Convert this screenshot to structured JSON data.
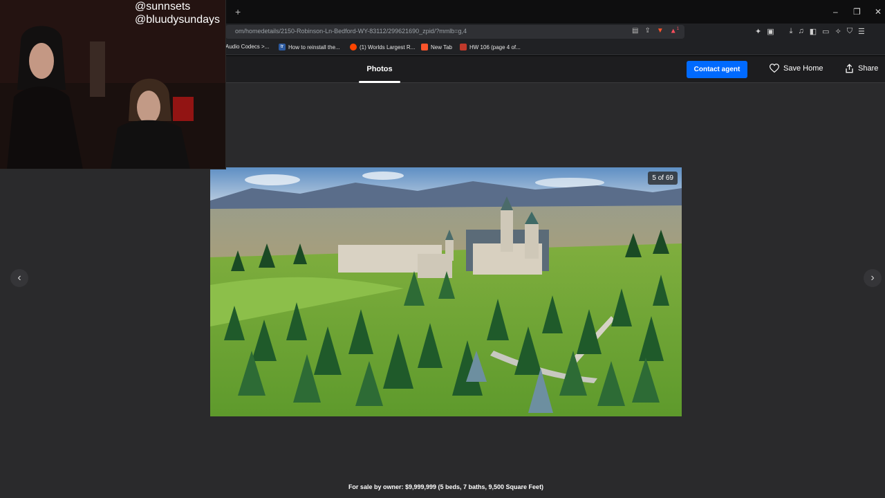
{
  "browser": {
    "url": "om/homedetails/2150-Robinson-Ln-Bedford-WY-83112/299621690_zpid/?mmlb=g,4",
    "new_tab_symbol": "+",
    "window_controls": {
      "minimize": "–",
      "restore": "❐",
      "close": "✕"
    },
    "rewards_badge": "1",
    "bookmarks": [
      {
        "label": "Audio Codecs >..."
      },
      {
        "label": "How to reinstall the...",
        "favicon": "tr"
      },
      {
        "label": "(1) Worlds Largest R..."
      },
      {
        "label": "New Tab"
      },
      {
        "label": "HW 106 (page 4 of..."
      }
    ]
  },
  "header": {
    "photos_tab": "Photos",
    "contact_button": "Contact agent",
    "save_label": "Save Home",
    "share_label": "Share"
  },
  "viewer": {
    "counter": "5 of 69",
    "prev_symbol": "‹",
    "next_symbol": "›"
  },
  "caption": "For sale by owner: $9,999,999 (5 beds, 7 baths, 9,500 Square Feet)",
  "overlay": {
    "handle_1": "@sunnsets",
    "handle_2": "@bluudysundays"
  },
  "colors": {
    "accent": "#006aff",
    "page_bg": "#2a2a2c",
    "header_bg": "#1d1d1f"
  }
}
